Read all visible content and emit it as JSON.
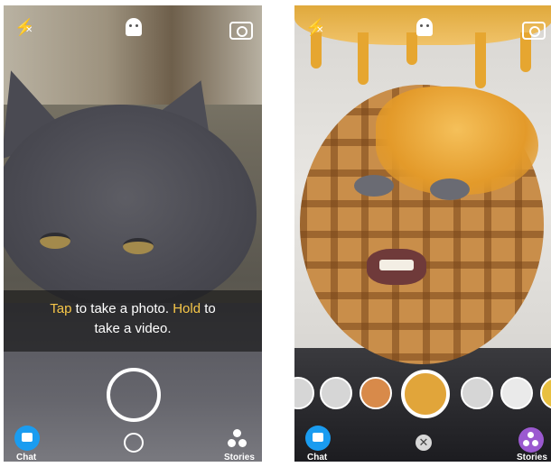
{
  "left_screen": {
    "tip_tap": "Tap",
    "tip_middle": "to take a photo.",
    "tip_hold": "Hold",
    "tip_to": "to",
    "tip_line2": "take a video.",
    "chat_label": "Chat",
    "stories_label": "Stories"
  },
  "right_screen": {
    "chat_label": "Chat",
    "stories_label": "Stories"
  },
  "icons": {
    "flash": "flash-off-icon",
    "ghost": "snapchat-ghost-icon",
    "flip": "camera-flip-icon",
    "close": "close-icon"
  },
  "colors": {
    "highlight": "#f7c748",
    "chat_blue": "#1a9cf0",
    "stories_purple": "#9b59d0"
  }
}
